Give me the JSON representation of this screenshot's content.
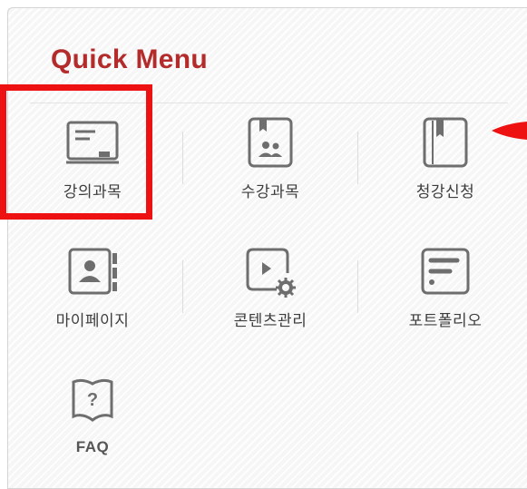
{
  "title": "Quick Menu",
  "menu": [
    {
      "label": "강의과목",
      "icon": "lecture-board-icon"
    },
    {
      "label": "수강과목",
      "icon": "enrolled-course-book-icon"
    },
    {
      "label": "청강신청",
      "icon": "bookmark-book-icon"
    },
    {
      "label": "마이페이지",
      "icon": "profile-card-icon"
    },
    {
      "label": "콘텐츠관리",
      "icon": "content-settings-icon"
    },
    {
      "label": "포트폴리오",
      "icon": "portfolio-document-icon"
    },
    {
      "label": "FAQ",
      "icon": "faq-book-icon"
    }
  ],
  "colors": {
    "title": "#b32b2b",
    "highlight": "#ee1111",
    "icon_stroke": "#6e6e6e",
    "label": "#3d3d3d"
  }
}
